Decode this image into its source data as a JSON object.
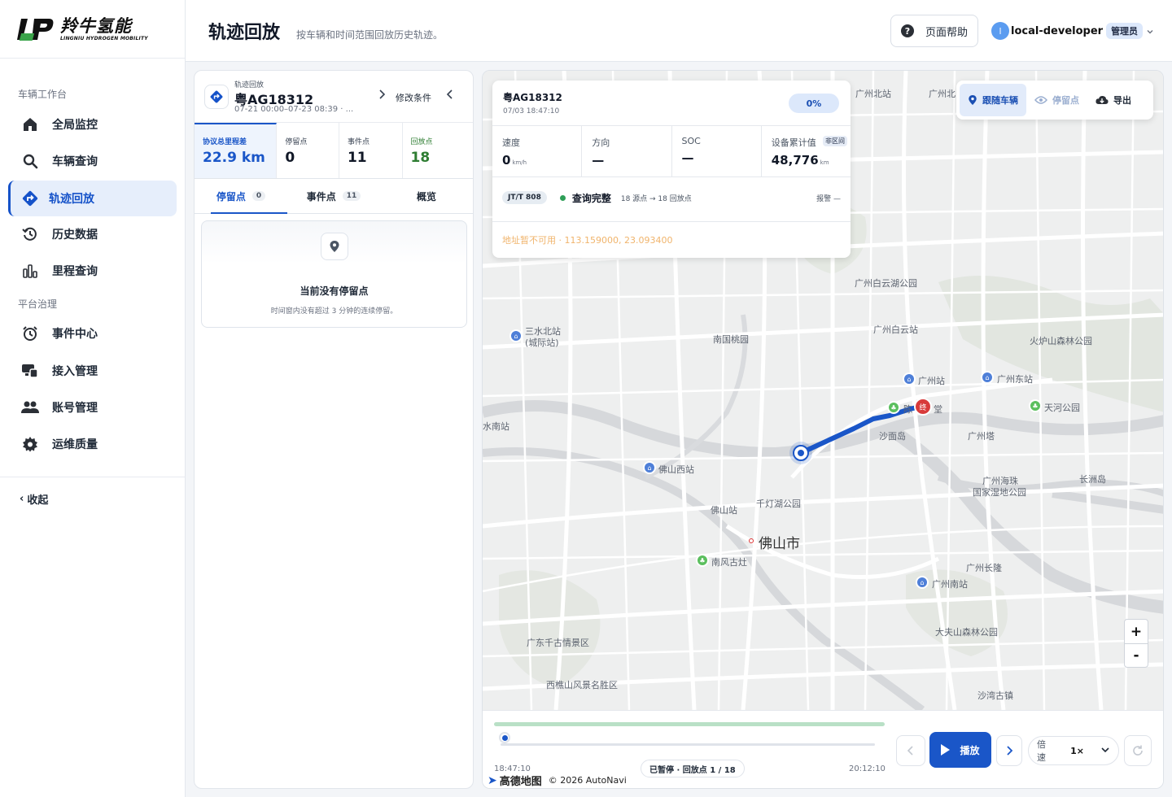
{
  "brand": {
    "name_cn": "羚牛氢能",
    "name_en": "LINGNIU HYDROGEN MOBILITY"
  },
  "sidebar": {
    "groups": [
      {
        "label": "车辆工作台"
      },
      {
        "label": "平台治理"
      }
    ],
    "items": [
      {
        "label": "全局监控",
        "icon": "home-icon"
      },
      {
        "label": "车辆查询",
        "icon": "search-icon"
      },
      {
        "label": "轨迹回放",
        "icon": "route-icon",
        "active": true
      },
      {
        "label": "历史数据",
        "icon": "history-icon"
      },
      {
        "label": "里程查询",
        "icon": "bar-chart-icon"
      },
      {
        "label": "事件中心",
        "icon": "alarm-clock-icon"
      },
      {
        "label": "接入管理",
        "icon": "devices-icon"
      },
      {
        "label": "账号管理",
        "icon": "users-icon"
      },
      {
        "label": "运维质量",
        "icon": "gear-icon"
      }
    ],
    "collapse_label": "收起"
  },
  "header": {
    "title": "轨迹回放",
    "subtitle": "按车辆和时间范围回放历史轨迹。",
    "help_label": "页面帮助",
    "user": {
      "avatar_letter": "l",
      "name": "local-developer",
      "role": "管理员"
    }
  },
  "left_panel": {
    "kicker": "轨迹回放",
    "plate": "粤AG18312",
    "range": "07-21 00:00–07-23 08:39 · ...",
    "edit_label": "修改条件",
    "stats": [
      {
        "label": "协议总里程差",
        "value": "22.9 km"
      },
      {
        "label": "停留点",
        "value": "0"
      },
      {
        "label": "事件点",
        "value": "11"
      },
      {
        "label": "回放点",
        "value": "18"
      }
    ],
    "tabs": [
      {
        "label": "停留点",
        "count": "0"
      },
      {
        "label": "事件点",
        "count": "11"
      },
      {
        "label": "概览",
        "count": ""
      }
    ],
    "empty": {
      "title": "当前没有停留点",
      "desc": "时间窗内没有超过 3 分钟的连续停留。"
    }
  },
  "vehicle_card": {
    "plate": "粤AG18312",
    "time": "07/03 18:47:10",
    "progress": "0%",
    "metrics": [
      {
        "label": "速度",
        "value": "0",
        "unit": "km/h"
      },
      {
        "label": "方向",
        "value": "—",
        "unit": ""
      },
      {
        "label": "SOC",
        "value": "—",
        "unit": ""
      },
      {
        "label": "设备累计值",
        "value": "48,776",
        "unit": "km",
        "tag": "非区间"
      }
    ],
    "protocol": "JT/T 808",
    "status": "查询完整",
    "points": "18 源点 → 18 回放点",
    "alarm": "报警 —",
    "address": "地址暂不可用 · 113.159000, 23.093400"
  },
  "map_toolbar": {
    "follow": "跟随车辆",
    "stops": "停留点",
    "export": "导出"
  },
  "map": {
    "labels": [
      "广州北站",
      "广州北",
      "广州白云湖公园",
      "三水北站",
      "(城际站)",
      "南国桃园",
      "广州白云站",
      "火炉山森林公园",
      "广州站",
      "广州东站",
      "天河公园",
      "陈",
      "堂",
      "沙面岛",
      "广州塔",
      "水南站",
      "佛山西站",
      "千灯湖公园",
      "佛山站",
      "佛山市",
      "广州海珠",
      "国家湿地公园",
      "长洲岛",
      "南风古灶",
      "广州长隆",
      "广州南站",
      "大夫山森林公园",
      "广东千古情景区",
      "西樵山风景名胜区",
      "沙湾古镇"
    ],
    "zoom_in": "+",
    "zoom_out": "-",
    "end_marker": "终",
    "copyright": "© 2026 AutoNavi",
    "provider": "高德地图"
  },
  "playback": {
    "start_time": "18:47:10",
    "end_time": "20:12:10",
    "status": "已暂停 · 回放点 1 / 18",
    "play_label": "播放",
    "speed_label": "倍速",
    "speed_value": "1×",
    "progress": 0
  }
}
